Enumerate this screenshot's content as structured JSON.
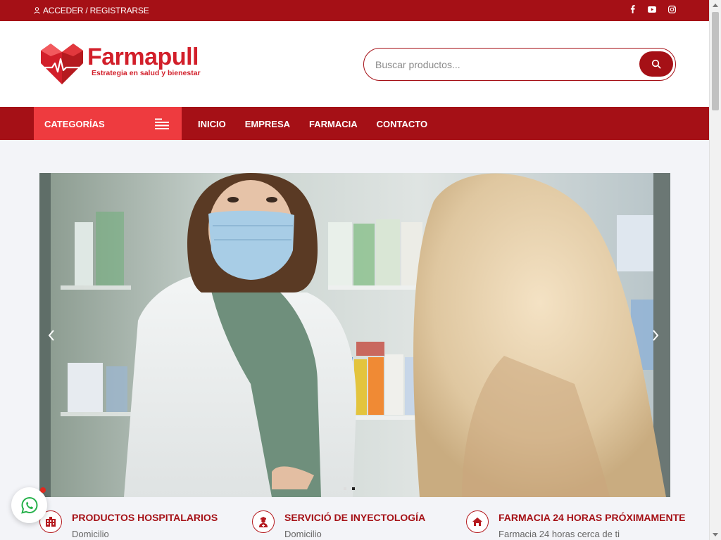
{
  "topbar": {
    "auth_label": "ACCEDER / REGISTRARSE",
    "social": [
      "facebook-icon",
      "youtube-icon",
      "instagram-icon"
    ]
  },
  "brand": {
    "name": "Farmapull",
    "tagline": "Estrategia en salud y bienestar",
    "color": "#d21f2a"
  },
  "search": {
    "placeholder": "Buscar productos..."
  },
  "nav": {
    "categories_label": "CATEGORÍAS",
    "links": [
      "INICIO",
      "EMPRESA",
      "FARMACIA",
      "CONTACTO"
    ]
  },
  "hero": {
    "slide_count": 2,
    "active_slide": 2
  },
  "features": [
    {
      "icon": "hospital-icon",
      "title": "PRODUCTOS HOSPITALARIOS",
      "subtitle": "Domicilio"
    },
    {
      "icon": "nurse-icon",
      "title": "SERVICIÓ DE INYECTOLOGÍA",
      "subtitle": "Domicilio"
    },
    {
      "icon": "home-icon",
      "title": "FARMACIA 24 HORAS PRÓXIMAMENTE",
      "subtitle": "Farmacia 24 horas cerca de ti"
    }
  ],
  "colors": {
    "primary": "#a51016",
    "accent": "#ee3b3f",
    "background": "#f3f4f8"
  }
}
